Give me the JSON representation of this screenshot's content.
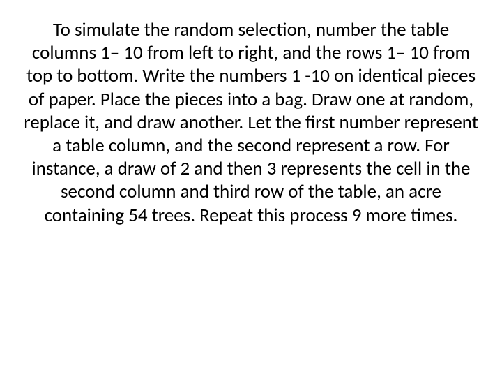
{
  "slide": {
    "body": "To simulate the random selection, number the table columns 1– 10 from left to right, and the rows 1– 10 from top to bottom.  Write the numbers 1 -10 on identical pieces of paper.  Place the pieces into a bag.  Draw one at random, replace it, and draw another.  Let the first number represent a table column, and the second represent a row.  For instance, a draw of 2 and then 3 represents the cell in the second column and third row of the table, an acre containing 54 trees. Repeat this process 9 more times."
  }
}
